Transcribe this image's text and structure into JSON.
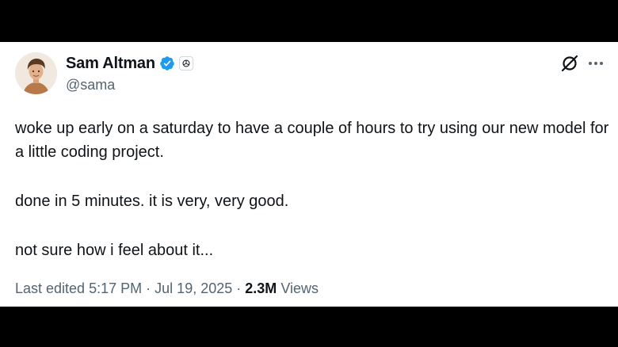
{
  "author": {
    "display_name": "Sam Altman",
    "handle": "@sama",
    "verified_badge_color": "#1d9bf0"
  },
  "icons": {
    "verified": "verified-badge-icon",
    "affiliate": "openai-affiliate-badge-icon",
    "grok": "grok-icon",
    "more": "more-options-icon"
  },
  "tweet": {
    "paragraphs": [
      "woke up early on a saturday to have a couple of hours to try using our new model for a little coding project.",
      "done in 5 minutes. it is very, very good.",
      "not sure how i feel about it..."
    ]
  },
  "meta": {
    "edited_label": "Last edited",
    "time": "5:17 PM",
    "separator": "·",
    "date": "Jul 19, 2025",
    "views_count": "2.3M",
    "views_label": "Views"
  },
  "colors": {
    "text_primary": "#0f1419",
    "text_secondary": "#536471",
    "background": "#ffffff",
    "letterbox": "#000000"
  }
}
